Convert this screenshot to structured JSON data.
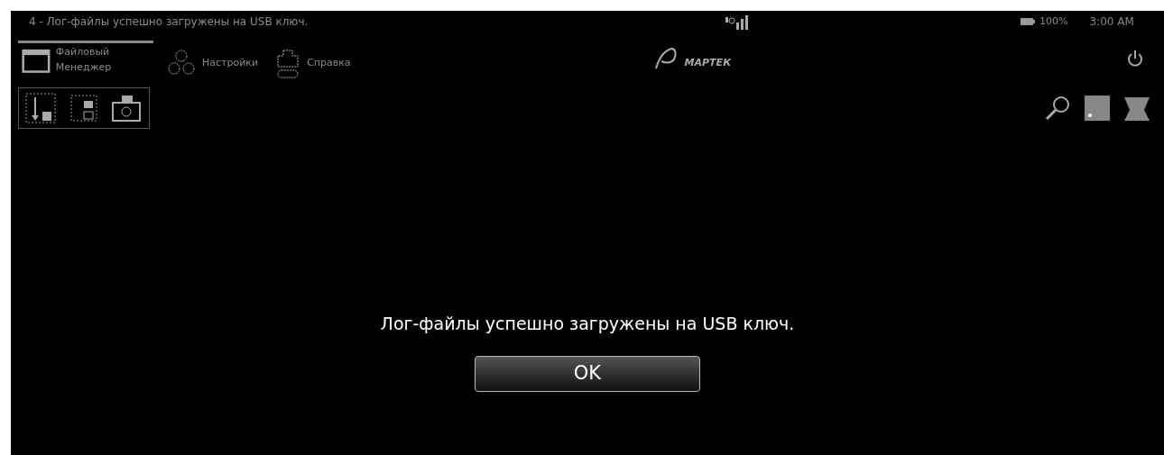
{
  "window": {
    "title": "4 - Лог-файлы успешно загружены на USB ключ."
  },
  "toolbar": [
    {
      "label": "Файловый Менеджер",
      "selected": true
    },
    {
      "label": "Настройки",
      "selected": false
    },
    {
      "label": "Справка",
      "selected": false
    }
  ],
  "logo": {
    "text": "МАРТЕК"
  },
  "status": {
    "battery": "100%",
    "time": "3:00 AM"
  },
  "dialog": {
    "message": "Лог-файлы успешно загружены на USB ключ.",
    "buttons": [
      "OK"
    ]
  }
}
